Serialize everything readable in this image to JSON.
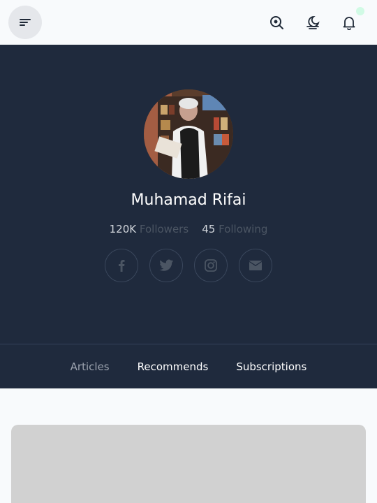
{
  "topbar": {
    "icons": [
      "menu-icon",
      "search-icon",
      "moon-icon",
      "bell-icon"
    ],
    "notification_dot_color": "#d1fae5"
  },
  "profile": {
    "name": "Muhamad Rifai",
    "followers_count": "120K",
    "followers_label": "Followers",
    "following_count": "45",
    "following_label": "Following",
    "socials": [
      "facebook-icon",
      "twitter-icon",
      "instagram-icon",
      "mail-icon"
    ]
  },
  "tabs": [
    {
      "label": "Articles",
      "active": false
    },
    {
      "label": "Recommends",
      "active": true
    },
    {
      "label": "Subscriptions",
      "active": true
    }
  ],
  "colors": {
    "hero_bg": "#1f2a3d",
    "page_bg": "#f8fafc",
    "card_bg": "#d1d1d1"
  }
}
